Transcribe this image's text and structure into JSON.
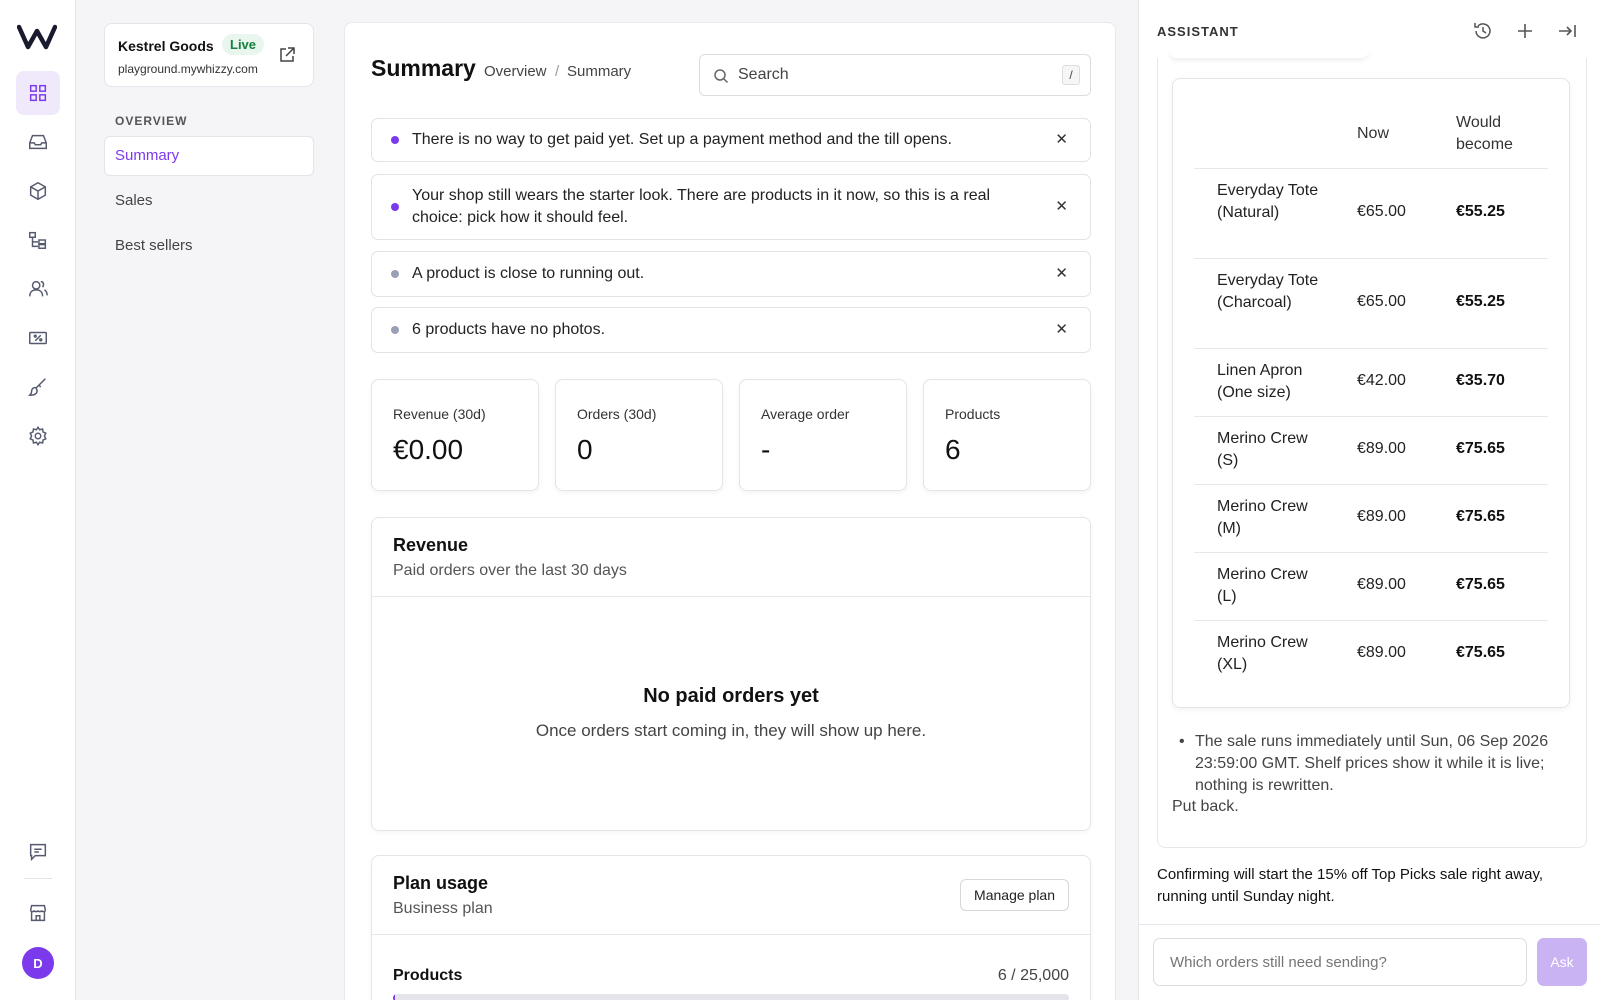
{
  "colors": {
    "accent": "#7c3aed",
    "live": "#15803d",
    "dot_active": "#7c3aed",
    "dot_muted": "#9aa0b4"
  },
  "rail": {
    "logo": "w-logo",
    "items": [
      {
        "icon": "dashboard-icon",
        "active": true
      },
      {
        "icon": "inbox-icon"
      },
      {
        "icon": "box-icon"
      },
      {
        "icon": "categories-icon"
      },
      {
        "icon": "customers-icon"
      },
      {
        "icon": "discount-icon"
      },
      {
        "icon": "brush-icon"
      },
      {
        "icon": "gear-icon"
      }
    ],
    "bottom": [
      {
        "icon": "chat-icon"
      },
      {
        "icon": "store-icon"
      }
    ],
    "avatar": "D"
  },
  "shop": {
    "name": "Kestrel Goods",
    "status": "Live",
    "url": "playground.mywhizzy.com"
  },
  "subnav": {
    "section": "OVERVIEW",
    "items": [
      {
        "label": "Summary",
        "active": true
      },
      {
        "label": "Sales"
      },
      {
        "label": "Best sellers"
      }
    ]
  },
  "header": {
    "title": "Summary",
    "breadcrumb": [
      "Overview",
      "Summary"
    ],
    "search_placeholder": "Search",
    "search_shortcut": "/"
  },
  "alerts": [
    {
      "text": "There is no way to get paid yet. Set up a payment method and the till opens.",
      "tone": "active"
    },
    {
      "text": "Your shop still wears the starter look. There are products in it now, so this is a real choice: pick how it should feel.",
      "tone": "active"
    },
    {
      "text": "A product is close to running out.",
      "tone": "muted"
    },
    {
      "text": "6 products have no photos.",
      "tone": "muted"
    }
  ],
  "stats": [
    {
      "label": "Revenue (30d)",
      "value": "€0.00"
    },
    {
      "label": "Orders (30d)",
      "value": "0"
    },
    {
      "label": "Average order",
      "value": "-"
    },
    {
      "label": "Products",
      "value": "6"
    }
  ],
  "revenue": {
    "title": "Revenue",
    "subtitle": "Paid orders over the last 30 days",
    "empty_title": "No paid orders yet",
    "empty_subtitle": "Once orders start coming in, they will show up here."
  },
  "plan": {
    "title": "Plan usage",
    "subtitle": "Business plan",
    "manage_label": "Manage plan",
    "usage_label": "Products",
    "usage_value": "6 / 25,000",
    "usage_fraction": 0.00024
  },
  "assistant": {
    "title": "ASSISTANT",
    "icons": [
      "history-icon",
      "plus-icon",
      "collapse-icon"
    ],
    "table": {
      "headers": [
        "",
        "Now",
        "Would become"
      ],
      "rows": [
        {
          "product": "Everyday Tote (Natural)",
          "now": "€65.00",
          "would": "€55.25"
        },
        {
          "product": "Everyday Tote (Charcoal)",
          "now": "€65.00",
          "would": "€55.25"
        },
        {
          "product": "Linen Apron (One size)",
          "now": "€42.00",
          "would": "€35.70"
        },
        {
          "product": "Merino Crew (S)",
          "now": "€89.00",
          "would": "€75.65"
        },
        {
          "product": "Merino Crew (M)",
          "now": "€89.00",
          "would": "€75.65"
        },
        {
          "product": "Merino Crew (L)",
          "now": "€89.00",
          "would": "€75.65"
        },
        {
          "product": "Merino Crew (XL)",
          "now": "€89.00",
          "would": "€75.65"
        }
      ]
    },
    "bullet": "The sale runs immediately until Sun, 06 Sep 2026 23:59:00 GMT. Shelf prices show it while it is live; nothing is rewritten.",
    "put_back": "Put back.",
    "confirm": "Confirming will start the 15% off Top Picks sale right away, running until Sunday night.",
    "input_placeholder": "Which orders still need sending?",
    "ask_label": "Ask"
  }
}
